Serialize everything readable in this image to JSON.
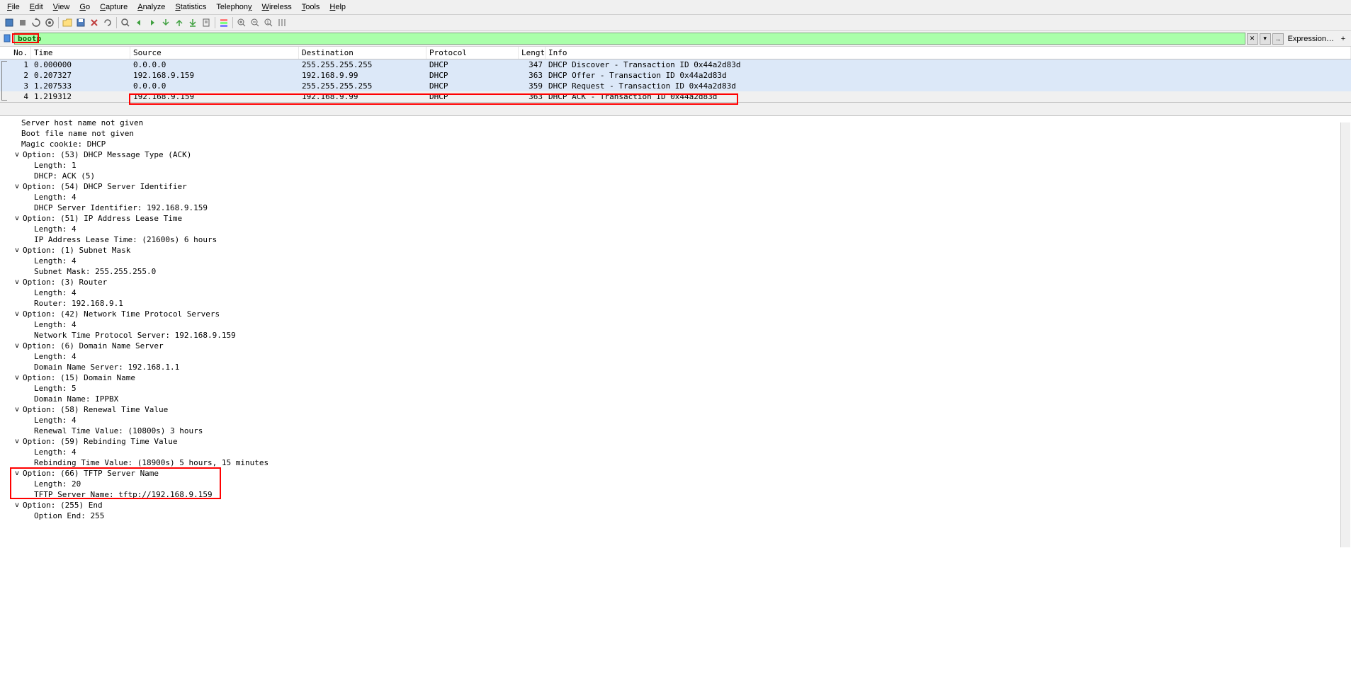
{
  "menu": {
    "file": "File",
    "edit": "Edit",
    "view": "View",
    "go": "Go",
    "capture": "Capture",
    "analyze": "Analyze",
    "statistics": "Statistics",
    "telephony": "Telephony",
    "wireless": "Wireless",
    "tools": "Tools",
    "help": "Help"
  },
  "filter": {
    "value": "bootp",
    "expression_label": "Expression…",
    "clear_glyph": "✕",
    "dropdown_glyph": "▾",
    "history_glyph": "→",
    "plus_glyph": "+"
  },
  "packet_columns": {
    "no": "No.",
    "time": "Time",
    "source": "Source",
    "destination": "Destination",
    "protocol": "Protocol",
    "length": "Length",
    "info": "Info"
  },
  "packets": [
    {
      "no": "1",
      "time": "0.000000",
      "src": "0.0.0.0",
      "dst": "255.255.255.255",
      "proto": "DHCP",
      "len": "347",
      "info": "DHCP Discover - Transaction ID 0x44a2d83d",
      "bg": "blue"
    },
    {
      "no": "2",
      "time": "0.207327",
      "src": "192.168.9.159",
      "dst": "192.168.9.99",
      "proto": "DHCP",
      "len": "363",
      "info": "DHCP Offer    - Transaction ID 0x44a2d83d",
      "bg": "blue"
    },
    {
      "no": "3",
      "time": "1.207533",
      "src": "0.0.0.0",
      "dst": "255.255.255.255",
      "proto": "DHCP",
      "len": "359",
      "info": "DHCP Request  - Transaction ID 0x44a2d83d",
      "bg": "blue"
    },
    {
      "no": "4",
      "time": "1.219312",
      "src": "192.168.9.159",
      "dst": "192.168.9.99",
      "proto": "DHCP",
      "len": "363",
      "info": "DHCP ACK      - Transaction ID 0x44a2d83d",
      "bg": "gray"
    }
  ],
  "details": [
    {
      "indent": 0,
      "caret": "",
      "text": "Server host name not given"
    },
    {
      "indent": 0,
      "caret": "",
      "text": "Boot file name not given"
    },
    {
      "indent": 0,
      "caret": "",
      "text": "Magic cookie: DHCP"
    },
    {
      "indent": 1,
      "caret": "v",
      "text": "Option: (53) DHCP Message Type (ACK)"
    },
    {
      "indent": 2,
      "caret": "",
      "text": "Length: 1"
    },
    {
      "indent": 2,
      "caret": "",
      "text": "DHCP: ACK (5)"
    },
    {
      "indent": 1,
      "caret": "v",
      "text": "Option: (54) DHCP Server Identifier"
    },
    {
      "indent": 2,
      "caret": "",
      "text": "Length: 4"
    },
    {
      "indent": 2,
      "caret": "",
      "text": "DHCP Server Identifier: 192.168.9.159"
    },
    {
      "indent": 1,
      "caret": "v",
      "text": "Option: (51) IP Address Lease Time"
    },
    {
      "indent": 2,
      "caret": "",
      "text": "Length: 4"
    },
    {
      "indent": 2,
      "caret": "",
      "text": "IP Address Lease Time: (21600s) 6 hours"
    },
    {
      "indent": 1,
      "caret": "v",
      "text": "Option: (1) Subnet Mask"
    },
    {
      "indent": 2,
      "caret": "",
      "text": "Length: 4"
    },
    {
      "indent": 2,
      "caret": "",
      "text": "Subnet Mask: 255.255.255.0"
    },
    {
      "indent": 1,
      "caret": "v",
      "text": "Option: (3) Router"
    },
    {
      "indent": 2,
      "caret": "",
      "text": "Length: 4"
    },
    {
      "indent": 2,
      "caret": "",
      "text": "Router: 192.168.9.1"
    },
    {
      "indent": 1,
      "caret": "v",
      "text": "Option: (42) Network Time Protocol Servers"
    },
    {
      "indent": 2,
      "caret": "",
      "text": "Length: 4"
    },
    {
      "indent": 2,
      "caret": "",
      "text": "Network Time Protocol Server: 192.168.9.159"
    },
    {
      "indent": 1,
      "caret": "v",
      "text": "Option: (6) Domain Name Server"
    },
    {
      "indent": 2,
      "caret": "",
      "text": "Length: 4"
    },
    {
      "indent": 2,
      "caret": "",
      "text": "Domain Name Server: 192.168.1.1"
    },
    {
      "indent": 1,
      "caret": "v",
      "text": "Option: (15) Domain Name"
    },
    {
      "indent": 2,
      "caret": "",
      "text": "Length: 5"
    },
    {
      "indent": 2,
      "caret": "",
      "text": "Domain Name: IPPBX"
    },
    {
      "indent": 1,
      "caret": "v",
      "text": "Option: (58) Renewal Time Value"
    },
    {
      "indent": 2,
      "caret": "",
      "text": "Length: 4"
    },
    {
      "indent": 2,
      "caret": "",
      "text": "Renewal Time Value: (10800s) 3 hours"
    },
    {
      "indent": 1,
      "caret": "v",
      "text": "Option: (59) Rebinding Time Value"
    },
    {
      "indent": 2,
      "caret": "",
      "text": "Length: 4"
    },
    {
      "indent": 2,
      "caret": "",
      "text": "Rebinding Time Value: (18900s) 5 hours, 15 minutes"
    },
    {
      "indent": 1,
      "caret": "v",
      "text": "Option: (66) TFTP Server Name"
    },
    {
      "indent": 2,
      "caret": "",
      "text": "Length: 20"
    },
    {
      "indent": 2,
      "caret": "",
      "text": "TFTP Server Name: tftp://192.168.9.159"
    },
    {
      "indent": 1,
      "caret": "v",
      "text": "Option: (255) End"
    },
    {
      "indent": 2,
      "caret": "",
      "text": "Option End: 255"
    }
  ]
}
